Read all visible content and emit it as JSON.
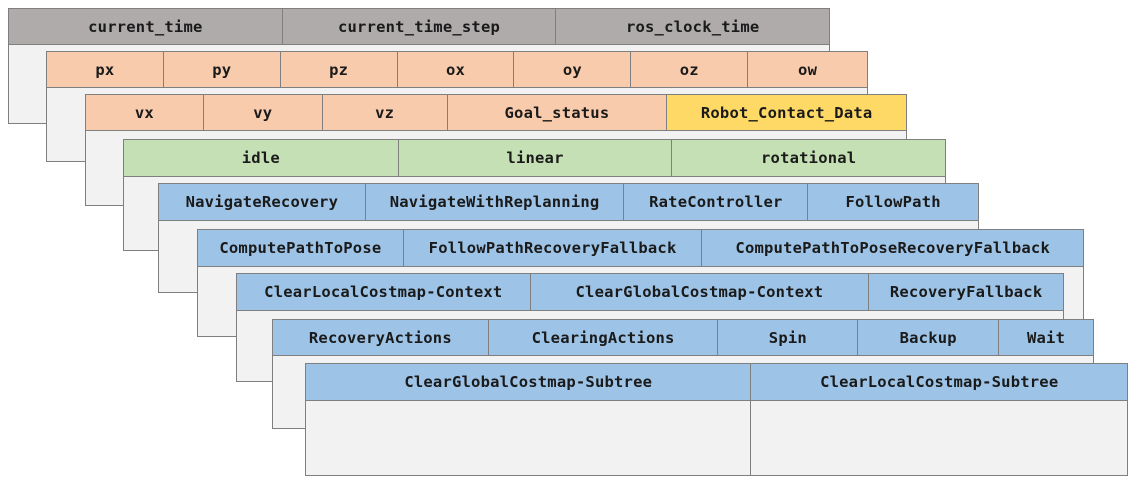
{
  "layers": [
    {
      "id": "layer-1",
      "cells": [
        "current_time",
        "current_time_step",
        "ros_clock_time"
      ]
    },
    {
      "id": "layer-2",
      "cells": [
        "px",
        "py",
        "pz",
        "ox",
        "oy",
        "oz",
        "ow"
      ]
    },
    {
      "id": "layer-3",
      "cells": [
        "vx",
        "vy",
        "vz",
        "Goal_status",
        "Robot_Contact_Data"
      ]
    },
    {
      "id": "layer-4",
      "cells": [
        "idle",
        "linear",
        "rotational"
      ]
    },
    {
      "id": "layer-5",
      "cells": [
        "NavigateRecovery",
        "NavigateWithReplanning",
        "RateController",
        "FollowPath"
      ]
    },
    {
      "id": "layer-6",
      "cells": [
        "ComputePathToPose",
        "FollowPathRecoveryFallback",
        "ComputePathToPoseRecoveryFallback"
      ]
    },
    {
      "id": "layer-7",
      "cells": [
        "ClearLocalCostmap-Context",
        "ClearGlobalCostmap-Context",
        "RecoveryFallback"
      ]
    },
    {
      "id": "layer-8",
      "cells": [
        "RecoveryActions",
        "ClearingActions",
        "Spin",
        "Backup",
        "Wait"
      ]
    },
    {
      "id": "layer-9",
      "cells": [
        "ClearGlobalCostmap-Subtree",
        "ClearLocalCostmap-Subtree"
      ]
    }
  ],
  "colors": {
    "gray": "#afabab",
    "orange": "#f8cbad",
    "yellow": "#ffd966",
    "green": "#c5e0b4",
    "blue": "#9dc3e6",
    "sheet": "#f2f2f2",
    "border": "#7f7f7f"
  }
}
